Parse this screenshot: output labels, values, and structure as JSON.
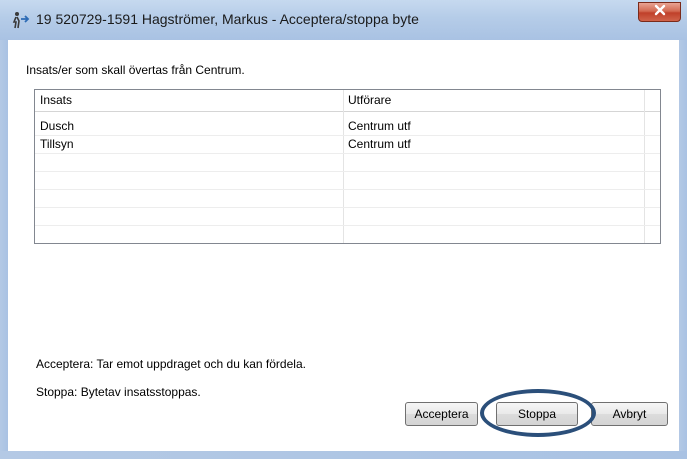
{
  "window": {
    "title": "19 520729-1591 Hagströmer, Markus - Acceptera/stoppa byte",
    "close_glyph": "x"
  },
  "dialog": {
    "prompt": "Insats/er som skall övertas från Centrum.",
    "columns": [
      "Insats",
      "Utförare"
    ],
    "rows": [
      {
        "insats": "Dusch",
        "utforare": "Centrum utf"
      },
      {
        "insats": "Tillsyn",
        "utforare": "Centrum utf"
      }
    ],
    "help_accept": "Acceptera: Tar emot uppdraget och du kan fördela.",
    "help_stop": "Stoppa: Bytetav insatsstoppas."
  },
  "buttons": {
    "accept": "Acceptera",
    "stop": "Stoppa",
    "cancel": "Avbryt"
  },
  "colors": {
    "titlebar": "#b5cce8",
    "close_button": "#c0402a",
    "highlight_ring": "#2b4f7a"
  }
}
